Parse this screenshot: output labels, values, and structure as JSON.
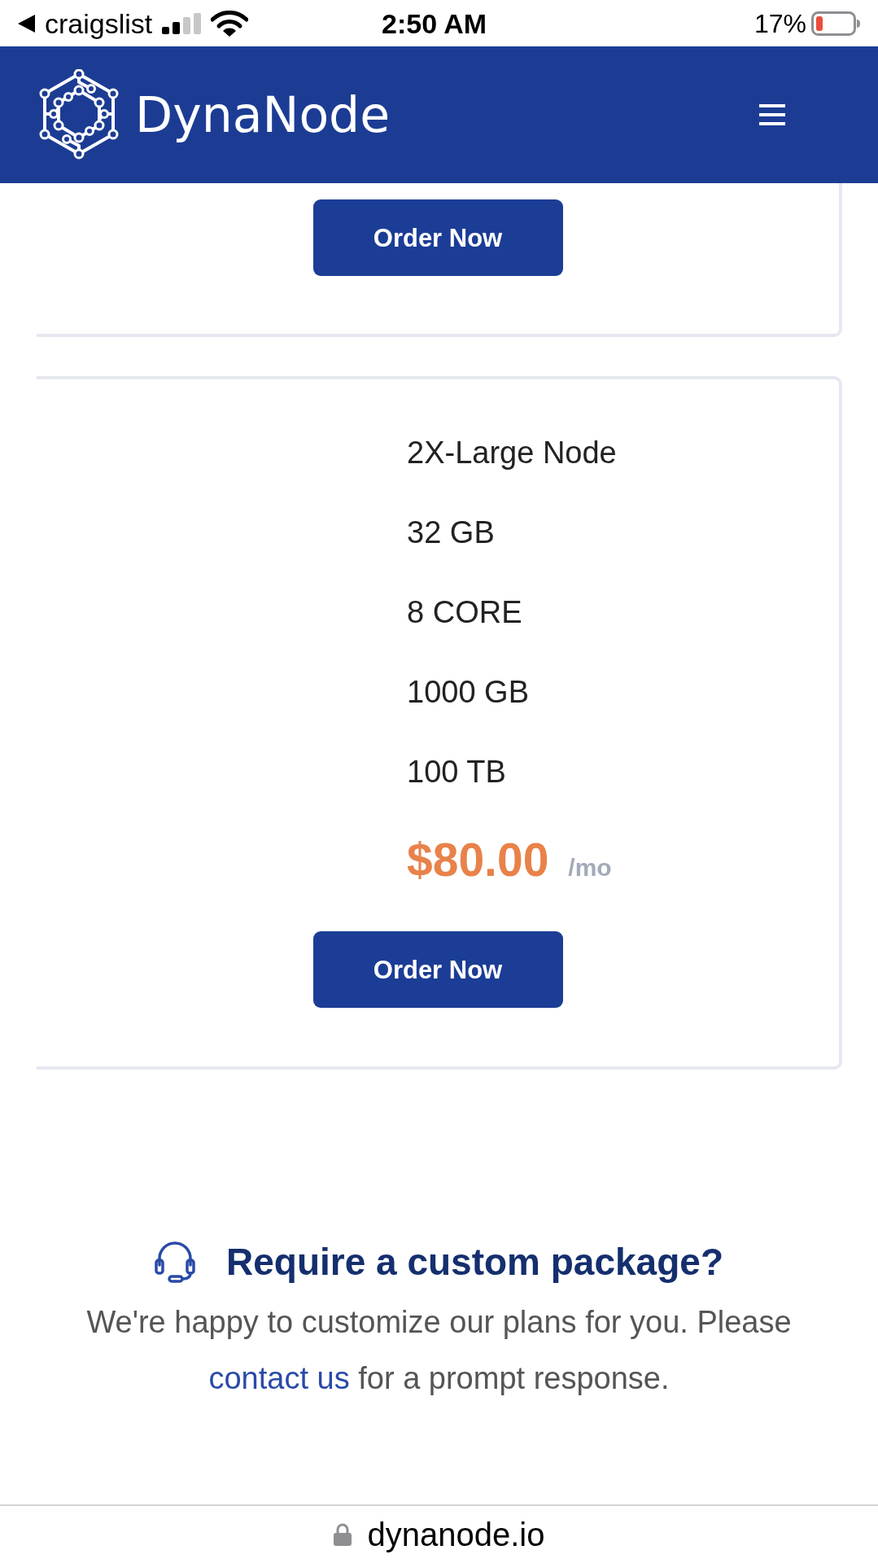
{
  "status_bar": {
    "back_label": "craigslist",
    "time": "2:50 AM",
    "battery": "17%"
  },
  "header": {
    "brand": "DynaNode"
  },
  "plans": [
    {
      "kind": "clipped",
      "button": "Order Now"
    },
    {
      "kind": "full",
      "features": [
        "2X-Large Node",
        "32 GB",
        "8 CORE",
        "1000 GB",
        "100 TB"
      ],
      "price": "$80.00",
      "period": "/mo",
      "button": "Order Now"
    }
  ],
  "custom_package": {
    "heading": "Require a custom package?",
    "text_before": "We're happy to customize our plans for you. Please",
    "link": "contact us",
    "text_after": "for a prompt response."
  },
  "address_bar": {
    "url": "dynanode.io"
  }
}
